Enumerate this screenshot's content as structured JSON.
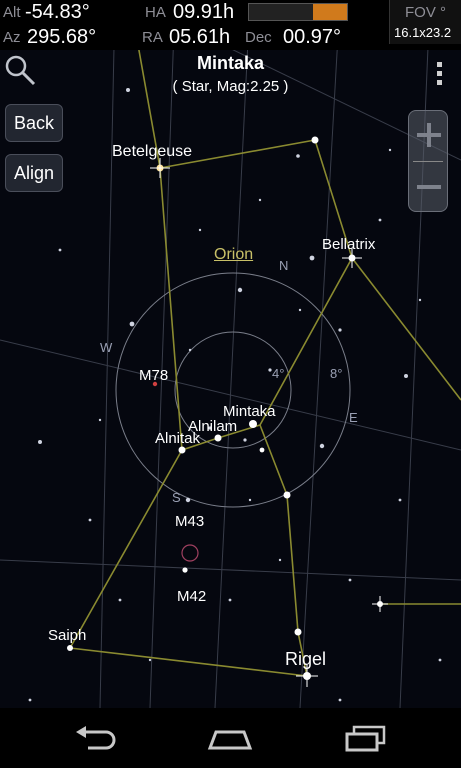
{
  "status": {
    "alt_key": "Alt",
    "alt_value": "-54.83°",
    "az_key": "Az",
    "az_value": "295.68°",
    "ha_key": "HA",
    "ha_value": "09.91h",
    "ra_key": "RA",
    "ra_value": "05.61h",
    "dec_key": "Dec",
    "dec_value": "00.97°",
    "fov_key": "FOV °",
    "fov_value": "16.1x23.2",
    "progress": 0.35,
    "progress_color": "#d07a1c"
  },
  "header": {
    "title": "Mintaka",
    "subtitle": "( Star, Mag:2.25 )",
    "search_icon": "search-icon",
    "menu_icon": "overflow-menu-icon"
  },
  "buttons": {
    "back": "Back",
    "align": "Align"
  },
  "zoom": {
    "in_icon": "plus-icon",
    "out_icon": "minus-icon"
  },
  "sky": {
    "constellation": "Orion",
    "labels": {
      "betelgeuse": "Betelgeuse",
      "bellatrix": "Bellatrix",
      "m78": "M78",
      "mintaka": "Mintaka",
      "alnilam": "Alnilam",
      "alnitak": "Alnitak",
      "m43": "M43",
      "m42": "M42",
      "saiph": "Saiph",
      "rigel": "Rigel"
    },
    "directions": {
      "n": "N",
      "w": "W",
      "e": "E",
      "s": "S"
    },
    "reticle": {
      "inner": "4°",
      "outer": "8°"
    },
    "constellation_line_color": "#8a8a30",
    "grid_color": "#5a6070"
  },
  "navbar": {
    "back": "back-icon",
    "home": "home-icon",
    "recents": "recents-icon"
  }
}
